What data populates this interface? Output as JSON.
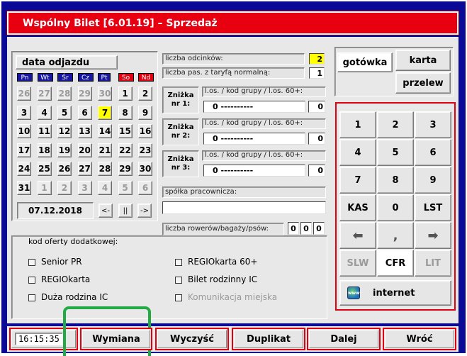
{
  "title": "Wspólny Bilet [6.01.19] – Sprzedaż",
  "calendar": {
    "header": "data odjazdu",
    "weekdays": [
      "Pn",
      "Wt",
      "Śr",
      "Cz",
      "Pt",
      "So",
      "Nd"
    ],
    "rows": [
      [
        "26",
        "27",
        "28",
        "29",
        "30",
        "1",
        "2"
      ],
      [
        "3",
        "4",
        "5",
        "6",
        "7",
        "8",
        "9"
      ],
      [
        "10",
        "11",
        "12",
        "13",
        "14",
        "15",
        "16"
      ],
      [
        "17",
        "18",
        "19",
        "20",
        "21",
        "22",
        "23"
      ],
      [
        "24",
        "25",
        "26",
        "27",
        "28",
        "29",
        "30"
      ],
      [
        "31",
        "1",
        "2",
        "3",
        "4",
        "5",
        "6"
      ]
    ],
    "selected_date": "07.12.2018",
    "nav_prev": "<-",
    "nav_pause": "||",
    "nav_next": "->"
  },
  "form": {
    "segments_label": "liczba odcinków:",
    "segments_value": "2",
    "normal_pass_label": "liczba pas. z taryfą normalną:",
    "normal_pass_value": "1",
    "discounts": [
      {
        "label": "Zniżka nr 1:",
        "sublabel": "l.os. / kod grupy / l.os. 60+:",
        "count": "0",
        "code": "----------",
        "count60": "0"
      },
      {
        "label": "Zniżka nr 2:",
        "sublabel": "l.os. / kod grupy / l.os. 60+:",
        "count": "0",
        "code": "----------",
        "count60": "0"
      },
      {
        "label": "Zniżka nr 3:",
        "sublabel": "l.os. / kod grupy / l.os. 60+:",
        "count": "0",
        "code": "----------",
        "count60": "0"
      }
    ],
    "company_label": "spółka pracownicza:",
    "company_value": "",
    "bikes_label": "liczba rowerów/bagaży/psów:",
    "bikes_values": [
      "0",
      "0",
      "0"
    ]
  },
  "offers": {
    "header": "kod oferty dodatkowej:",
    "left": [
      "Senior PR",
      "REGIOkarta",
      "Duża rodzina IC"
    ],
    "right": [
      "REGIOkarta 60+",
      "Bilet rodzinny IC",
      "Komunikacja miejska"
    ]
  },
  "payment": {
    "cash": "gotówka",
    "card": "karta",
    "transfer": "przelew"
  },
  "keypad": {
    "keys": [
      "1",
      "2",
      "3",
      "4",
      "5",
      "6",
      "7",
      "8",
      "9",
      "KAS",
      "0",
      "LST",
      "⬅",
      ",",
      "➡",
      "SLW",
      "CFR",
      "LIT"
    ],
    "internet": "internet"
  },
  "bottom": {
    "clock": "16:15:35",
    "buttons": [
      "Wymiana",
      "Wyczyść",
      "Duplikat",
      "Dalej",
      "Wróć"
    ]
  },
  "colors": {
    "frame": "#0a0a96",
    "accent": "#e80010",
    "highlight": "#ffff00",
    "focus_box": "#22aa44"
  }
}
